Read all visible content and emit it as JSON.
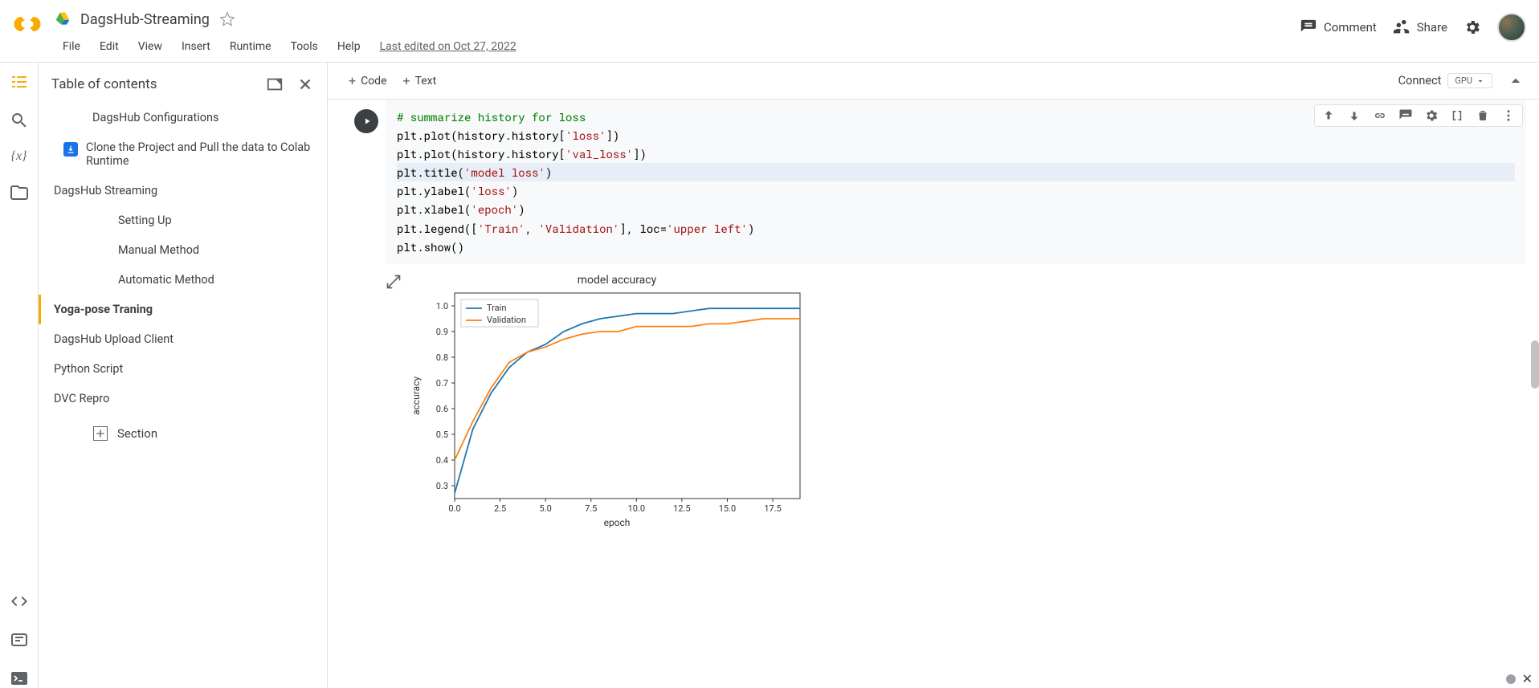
{
  "header": {
    "notebook_title": "DagsHub-Streaming",
    "menus": [
      "File",
      "Edit",
      "View",
      "Insert",
      "Runtime",
      "Tools",
      "Help"
    ],
    "last_edited": "Last edited on Oct 27, 2022",
    "comment_label": "Comment",
    "share_label": "Share"
  },
  "toc": {
    "title": "Table of contents",
    "items": [
      {
        "label": "DagsHub Configurations",
        "level": 1
      },
      {
        "label": "Clone the Project and Pull the data to Colab Runtime",
        "level": 0,
        "icon": "blue-arrow"
      },
      {
        "label": "DagsHub Streaming",
        "level": 0
      },
      {
        "label": "Setting Up",
        "level": 2
      },
      {
        "label": "Manual Method",
        "level": 2
      },
      {
        "label": "Automatic Method",
        "level": 2
      },
      {
        "label": "Yoga-pose Traning",
        "level": 0,
        "selected": true
      },
      {
        "label": "DagsHub Upload Client",
        "level": 0
      },
      {
        "label": "Python Script",
        "level": 0
      },
      {
        "label": "DVC Repro",
        "level": 0
      }
    ],
    "section_label": "Section"
  },
  "toolbar": {
    "add_code": "Code",
    "add_text": "Text",
    "connect": "Connect",
    "gpu": "GPU"
  },
  "code_cell": {
    "lines": [
      {
        "type": "comment",
        "text": "# summarize history for loss"
      },
      {
        "type": "code",
        "parts": [
          "plt.plot",
          "(",
          "history.history",
          "[",
          "'loss'",
          "]",
          ")"
        ]
      },
      {
        "type": "code",
        "parts": [
          "plt.plot",
          "(",
          "history.history",
          "[",
          "'val_loss'",
          "]",
          ")"
        ]
      },
      {
        "type": "code",
        "highlighted": true,
        "parts": [
          "plt.title",
          "(",
          "'model loss'",
          ")"
        ]
      },
      {
        "type": "code",
        "parts": [
          "plt.ylabel",
          "(",
          "'loss'",
          ")"
        ]
      },
      {
        "type": "code",
        "parts": [
          "plt.xlabel",
          "(",
          "'epoch'",
          ")"
        ]
      },
      {
        "type": "code",
        "parts": [
          "plt.legend",
          "(",
          "[",
          "'Train'",
          ", ",
          "'Validation'",
          "]",
          ", loc=",
          "'upper left'",
          ")"
        ]
      },
      {
        "type": "code",
        "parts": [
          "plt.show",
          "(",
          ")"
        ]
      }
    ]
  },
  "chart_data": {
    "type": "line",
    "title": "model accuracy",
    "xlabel": "epoch",
    "ylabel": "accuracy",
    "x": [
      0.0,
      2.5,
      5.0,
      7.5,
      10.0,
      12.5,
      15.0,
      17.5
    ],
    "xlim": [
      0,
      19
    ],
    "ylim": [
      0.25,
      1.05
    ],
    "yticks": [
      0.3,
      0.4,
      0.5,
      0.6,
      0.7,
      0.8,
      0.9,
      1.0
    ],
    "series": [
      {
        "name": "Train",
        "color": "#1f77b4",
        "points": [
          [
            0,
            0.27
          ],
          [
            1,
            0.52
          ],
          [
            2,
            0.66
          ],
          [
            3,
            0.76
          ],
          [
            4,
            0.82
          ],
          [
            5,
            0.85
          ],
          [
            6,
            0.9
          ],
          [
            7,
            0.93
          ],
          [
            8,
            0.95
          ],
          [
            9,
            0.96
          ],
          [
            10,
            0.97
          ],
          [
            11,
            0.97
          ],
          [
            12,
            0.97
          ],
          [
            13,
            0.98
          ],
          [
            14,
            0.99
          ],
          [
            15,
            0.99
          ],
          [
            16,
            0.99
          ],
          [
            17,
            0.99
          ],
          [
            18,
            0.99
          ],
          [
            19,
            0.99
          ]
        ]
      },
      {
        "name": "Validation",
        "color": "#ff7f0e",
        "points": [
          [
            0,
            0.4
          ],
          [
            1,
            0.55
          ],
          [
            2,
            0.68
          ],
          [
            3,
            0.78
          ],
          [
            4,
            0.82
          ],
          [
            5,
            0.84
          ],
          [
            6,
            0.87
          ],
          [
            7,
            0.89
          ],
          [
            8,
            0.9
          ],
          [
            9,
            0.9
          ],
          [
            10,
            0.92
          ],
          [
            11,
            0.92
          ],
          [
            12,
            0.92
          ],
          [
            13,
            0.92
          ],
          [
            14,
            0.93
          ],
          [
            15,
            0.93
          ],
          [
            16,
            0.94
          ],
          [
            17,
            0.95
          ],
          [
            18,
            0.95
          ],
          [
            19,
            0.95
          ]
        ]
      }
    ],
    "legend": [
      "Train",
      "Validation"
    ]
  }
}
